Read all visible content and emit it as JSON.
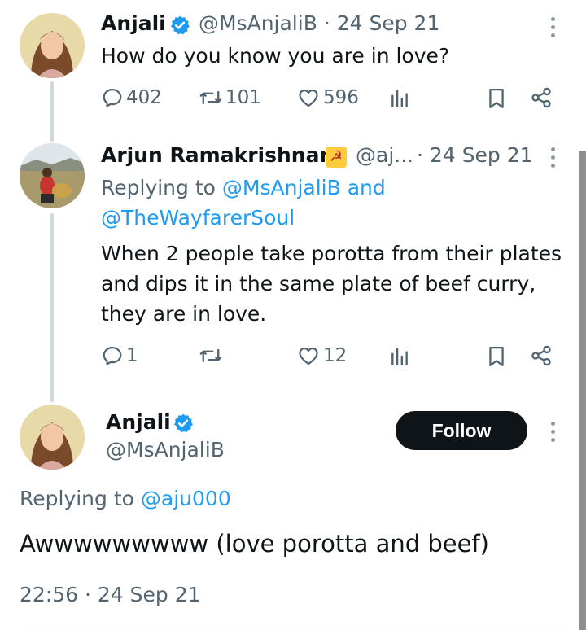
{
  "tweet1": {
    "author_name": "Anjali",
    "handle": "@MsAnjaliB",
    "separator": "·",
    "date": "24 Sep 21",
    "text": "How do you know you are in love?",
    "stats": {
      "replies": "402",
      "retweets": "101",
      "likes": "596"
    }
  },
  "tweet2": {
    "author_name": "Arjun Ramakrishnan",
    "flag_emoji": "☭",
    "handle": "@aj...",
    "separator": "·",
    "date": "24 Sep 21",
    "replying_prefix": "Replying to",
    "replying_user1": "@MsAnjaliB",
    "replying_and": "and",
    "replying_user2": "@TheWayfarerSoul",
    "text_line1": "When 2 people take porotta from their plates",
    "text_line2": "and dips it in the same plate of beef curry,",
    "text_line3": "they are in love.",
    "stats": {
      "replies": "1",
      "retweets": "",
      "likes": "12"
    }
  },
  "tweet3": {
    "author_name": "Anjali",
    "handle": "@MsAnjaliB",
    "follow_label": "Follow",
    "replying_prefix": "Replying to",
    "replying_user": "@aju000",
    "text": "Awwwwwwwww (love porotta and beef)",
    "timestamp": "22:56 · 24 Sep 21"
  },
  "colors": {
    "verified": "#1d9bf0",
    "link": "#1d9bf0",
    "muted": "#536471",
    "follow_bg": "#0f1419"
  },
  "icons": [
    "reply-icon",
    "retweet-icon",
    "like-icon",
    "views-icon",
    "bookmark-icon",
    "share-icon",
    "verified-badge-icon",
    "more-icon"
  ]
}
